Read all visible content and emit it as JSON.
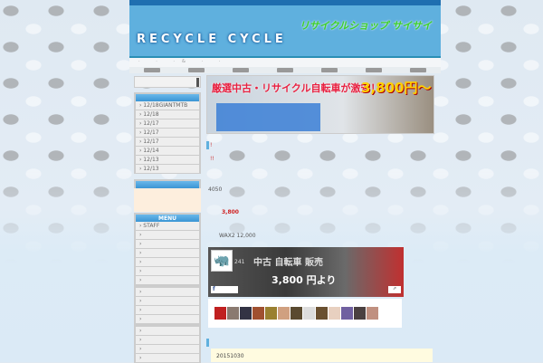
{
  "header": {
    "logo_text": "RECYCLE CYCLE",
    "shop_name": "リサイクルショップ サイサイ"
  },
  "nav": {
    "items": [
      "·",
      "·",
      "·&",
      "·",
      "·"
    ]
  },
  "sidebar": {
    "recent_posts": [
      "12/18GIANTMTB",
      "12/18",
      "12/17",
      "12/17",
      "12/17",
      "12/14",
      "12/13",
      "12/13"
    ],
    "menu_title": "MENU",
    "menu_items": [
      "STAFF",
      "",
      "",
      "",
      "",
      "",
      ""
    ],
    "menu_items2": [
      "",
      "",
      "",
      ""
    ],
    "menu_items3": [
      "",
      "",
      "",
      ""
    ]
  },
  "banner": {
    "text": "厳選中古・リサイクル自転車が激安！",
    "price": "3,800円〜"
  },
  "post": {
    "line1": "!",
    "line2": "!!",
    "line3": "4050",
    "line4": "3,800",
    "line5": "WAX2 12,000"
  },
  "facebook": {
    "count": "241",
    "sign": "中古 自転車 販売",
    "price": "3,800 円より",
    "like_label": "f",
    "share_label": "⇗"
  },
  "fan_colors": [
    "#c02020",
    "#8a7a70",
    "#334",
    "#a05030",
    "#9a8030",
    "#d0a080",
    "#5a4a30",
    "#ddd",
    "#6a5030",
    "#e8d0c0",
    "#7060a0",
    "#4a4040",
    "#c09080"
  ],
  "archive": {
    "date": "20151030"
  }
}
